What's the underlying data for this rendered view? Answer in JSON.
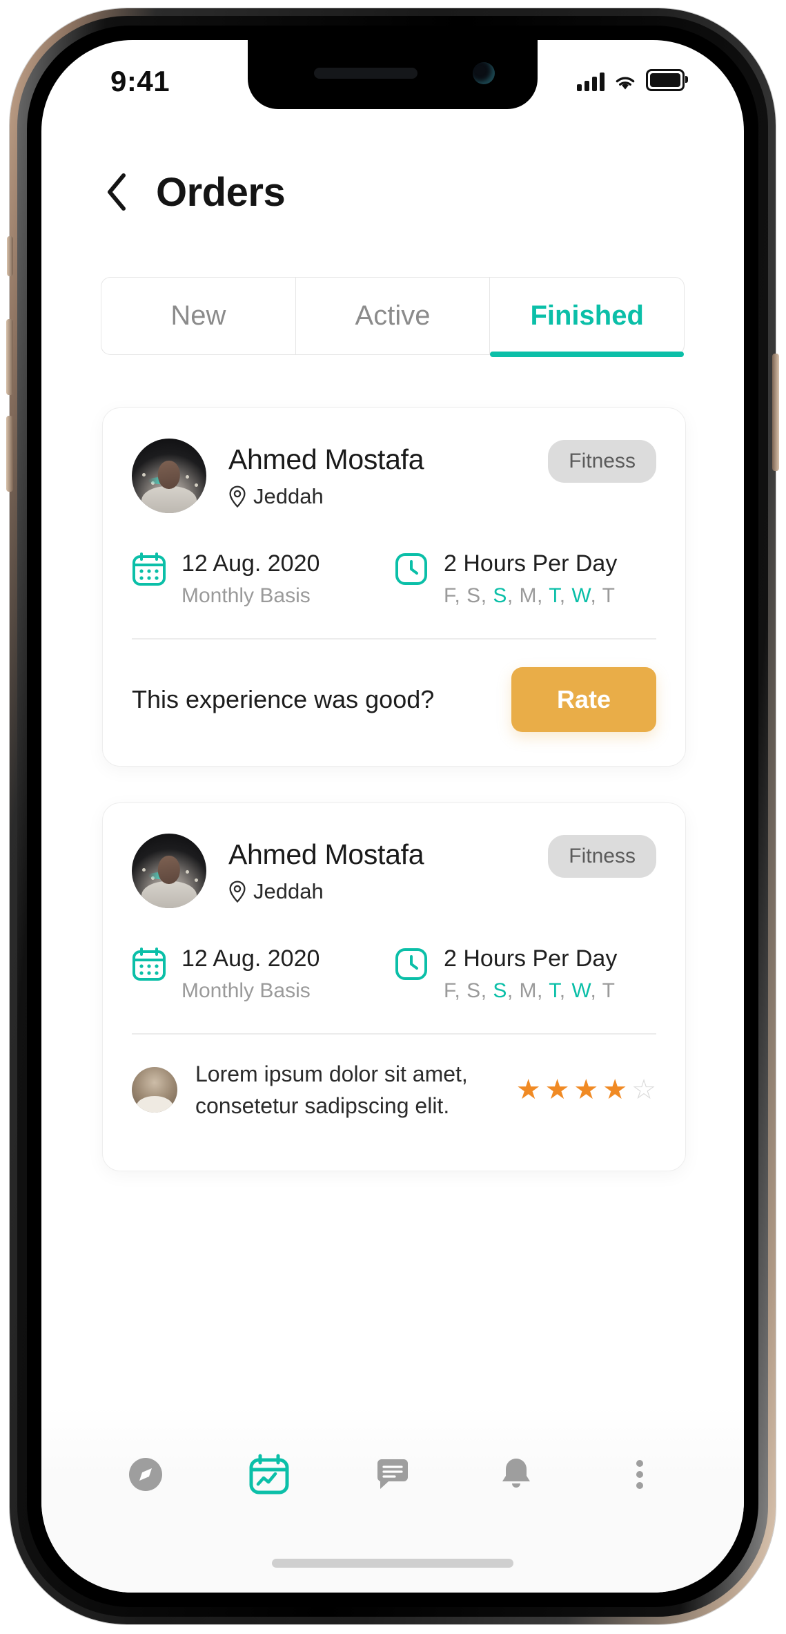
{
  "status_bar": {
    "time": "9:41",
    "icons": [
      "signal-bars-icon",
      "wifi-icon",
      "battery-icon"
    ]
  },
  "header": {
    "back_icon": "chevron-left-icon",
    "title": "Orders"
  },
  "tabs": [
    {
      "label": "New",
      "active": false
    },
    {
      "label": "Active",
      "active": false
    },
    {
      "label": "Finished",
      "active": true
    }
  ],
  "accent_colors": {
    "teal": "#0bbfa8",
    "orange_button": "#e9ad48",
    "star": "#f08a24",
    "star_empty": "#d9d9d9",
    "badge_bg": "#dcdcdc",
    "muted_text": "#9a9a9a"
  },
  "orders": [
    {
      "name": "Ahmed Mostafa",
      "location": "Jeddah",
      "location_icon": "map-pin-icon",
      "category_badge": "Fitness",
      "date": "12 Aug. 2020",
      "date_sub": "Monthly Basis",
      "date_icon": "calendar-icon",
      "duration": "2 Hours Per Day",
      "duration_icon": "clock-icon",
      "days": [
        {
          "letter": "F",
          "selected": false
        },
        {
          "letter": "S",
          "selected": false
        },
        {
          "letter": "S",
          "selected": true
        },
        {
          "letter": "M",
          "selected": false
        },
        {
          "letter": "T",
          "selected": true
        },
        {
          "letter": "W",
          "selected": true
        },
        {
          "letter": "T",
          "selected": false
        }
      ],
      "footer_type": "rate",
      "rate_question": "This experience was good?",
      "rate_button": "Rate"
    },
    {
      "name": "Ahmed Mostafa",
      "location": "Jeddah",
      "location_icon": "map-pin-icon",
      "category_badge": "Fitness",
      "date": "12 Aug. 2020",
      "date_sub": "Monthly Basis",
      "date_icon": "calendar-icon",
      "duration": "2 Hours Per Day",
      "duration_icon": "clock-icon",
      "days": [
        {
          "letter": "F",
          "selected": false
        },
        {
          "letter": "S",
          "selected": false
        },
        {
          "letter": "S",
          "selected": true
        },
        {
          "letter": "M",
          "selected": false
        },
        {
          "letter": "T",
          "selected": true
        },
        {
          "letter": "W",
          "selected": true
        },
        {
          "letter": "T",
          "selected": false
        }
      ],
      "footer_type": "review",
      "review_text": "Lorem ipsum dolor sit amet, consetetur sadipscing elit.",
      "rating": 4,
      "rating_max": 5
    }
  ],
  "bottom_nav": [
    {
      "icon": "compass-icon",
      "active": false
    },
    {
      "icon": "calendar-activity-icon",
      "active": true
    },
    {
      "icon": "chat-bubble-icon",
      "active": false
    },
    {
      "icon": "bell-icon",
      "active": false
    },
    {
      "icon": "more-vertical-icon",
      "active": false
    }
  ]
}
